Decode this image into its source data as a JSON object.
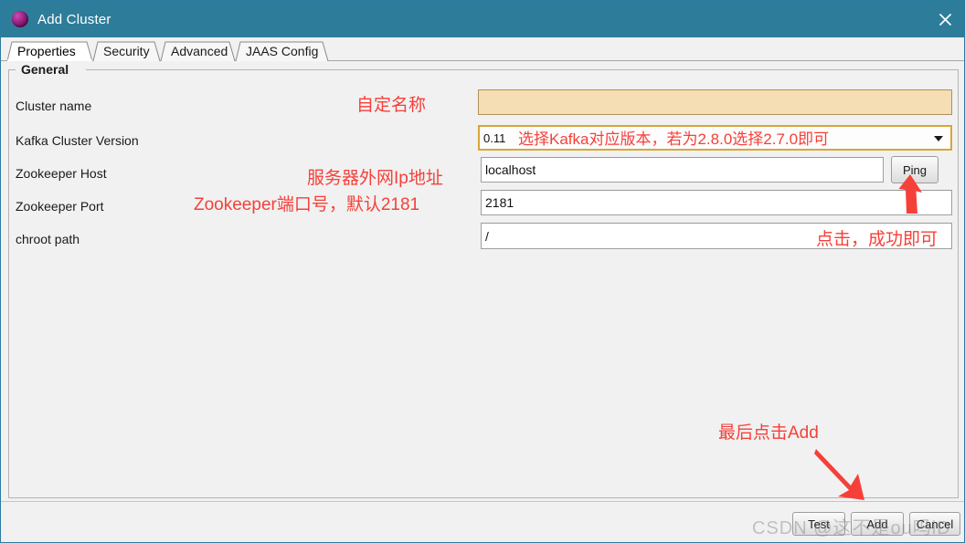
{
  "window": {
    "title": "Add Cluster",
    "icon": "sphere-icon",
    "close_label": "✕",
    "titlebar_color": "#2d7d9a"
  },
  "tabs": [
    {
      "label": "Properties",
      "active": true
    },
    {
      "label": "Security",
      "active": false
    },
    {
      "label": "Advanced",
      "active": false
    },
    {
      "label": "JAAS Config",
      "active": false
    }
  ],
  "group": {
    "title": "General"
  },
  "fields": [
    {
      "label": "Cluster name",
      "value": "",
      "type": "text-focused"
    },
    {
      "label": "Kafka Cluster Version",
      "value": "0.11",
      "type": "combo"
    },
    {
      "label": "Zookeeper Host",
      "value": "localhost",
      "type": "text"
    },
    {
      "label": "Zookeeper Port",
      "value": "2181",
      "type": "text"
    },
    {
      "label": "chroot path",
      "value": "/",
      "type": "text"
    }
  ],
  "ping_button": {
    "label": "Ping"
  },
  "buttons": [
    {
      "label": "Test"
    },
    {
      "label": "Add"
    },
    {
      "label": "Cancel"
    }
  ],
  "annotations": [
    {
      "text": "自定名称"
    },
    {
      "text": "选择Kafka对应版本，若为2.8.0选择2.7.0即可"
    },
    {
      "text": "服务器外网Ip地址"
    },
    {
      "text": "Zookeeper端口号，默认2181"
    },
    {
      "text": "点击，成功即可"
    },
    {
      "text": "最后点击Add"
    }
  ],
  "watermark": {
    "text": "CSDN @这不是ou吗iD"
  },
  "colors": {
    "annotation_red": "#f5403a",
    "titlebar": "#2d7d9a",
    "focused_field": "#f5ddb4",
    "combo_border": "#d8a638"
  }
}
